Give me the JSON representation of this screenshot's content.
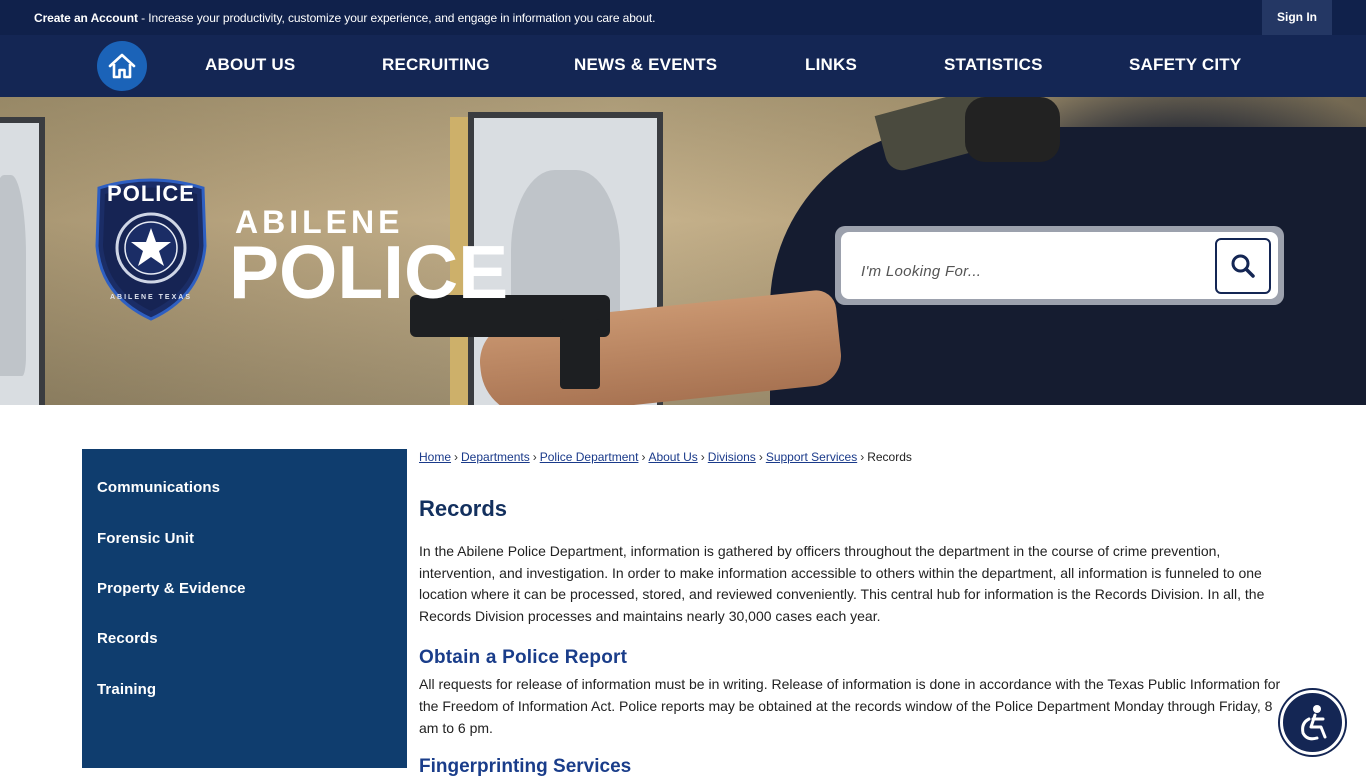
{
  "topbar": {
    "account_link": "Create an Account",
    "promo_text": " - Increase your productivity, customize your experience, and engage in information you care about.",
    "signin_label": "Sign In"
  },
  "nav": {
    "items": [
      "ABOUT US",
      "RECRUITING",
      "NEWS & EVENTS",
      "LINKS",
      "STATISTICS",
      "SAFETY CITY"
    ]
  },
  "logo": {
    "badge_top": "POLICE",
    "badge_bottom": "ABILENE TEXAS",
    "small": "ABILENE",
    "big": "POLICE"
  },
  "search": {
    "placeholder": "I'm Looking For..."
  },
  "sidebar": {
    "items": [
      "Communications",
      "Forensic Unit",
      "Property & Evidence",
      "Records",
      "Training"
    ]
  },
  "breadcrumb": {
    "links": [
      "Home",
      "Departments",
      "Police Department",
      "About Us",
      "Divisions",
      "Support Services"
    ],
    "current": "Records"
  },
  "main": {
    "title": "Records",
    "intro": "In the Abilene Police Department, information is gathered by officers throughout the department in the course of crime prevention, intervention, and investigation. In order to make information accessible to others within the department, all information is funneled to one location where it can be processed, stored, and reviewed conveniently. This central hub for information is the Records Division. In all, the Records Division processes and maintains nearly 30,000 cases each year.",
    "section1_title": "Obtain a Police Report",
    "section1_text": "All requests for release of information must be in writing. Release of information is done in accordance with the Texas Public Information for the Freedom of Information Act. Police reports may be obtained at the records window of the Police Department Monday through Friday, 8 am to 6 pm.",
    "section2_title": "Fingerprinting Services"
  },
  "colors": {
    "topbar": "#10214b",
    "nav": "#142654",
    "home_button": "#1b63b8",
    "sidebar": "#0f3d6e",
    "heading": "#13305e"
  },
  "icons": {
    "home": "home-icon",
    "search": "search-icon",
    "accessibility": "accessibility-icon"
  }
}
